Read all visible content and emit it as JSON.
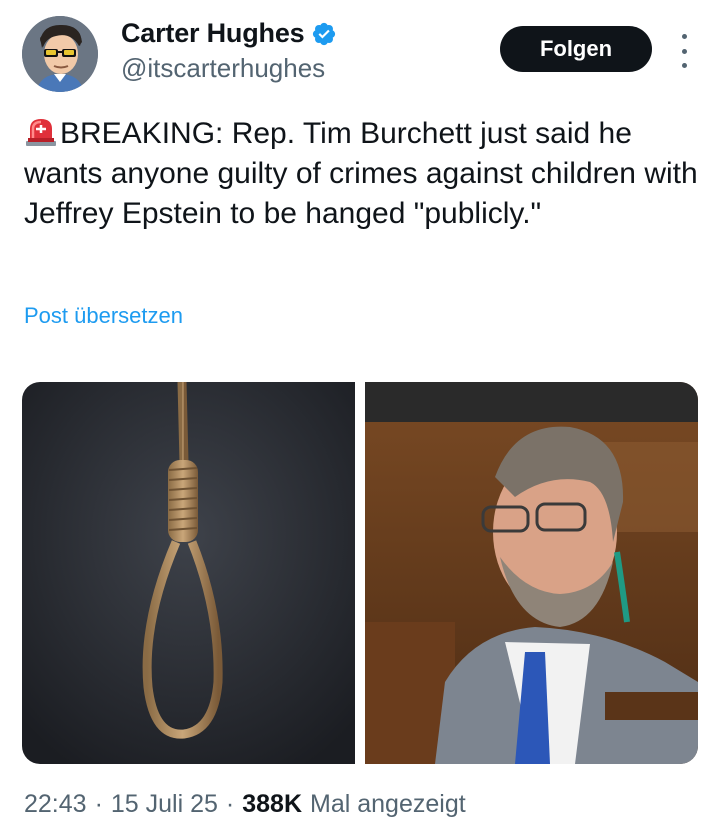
{
  "author": {
    "name": "Carter Hughes",
    "handle": "@itscarterhughes",
    "follow_label": "Folgen",
    "verified_color": "#1d9bf0"
  },
  "post": {
    "text": "BREAKING: Rep. Tim Burchett just said he wants anyone guilty of crimes against children with Jeffrey Epstein to be hanged \"publicly.\"",
    "translate_label": "Post übersetzen",
    "media": [
      {
        "subject": "noose-image"
      },
      {
        "subject": "man-portrait-image"
      }
    ]
  },
  "meta": {
    "time": "22:43",
    "sep1": "·",
    "date": "15 Juli 25",
    "sep2": "·",
    "views_count": "388K",
    "views_label": "Mal angezeigt"
  },
  "icons": {
    "siren": "siren-icon",
    "verified": "verified-badge-icon",
    "more": "more-options-icon"
  }
}
